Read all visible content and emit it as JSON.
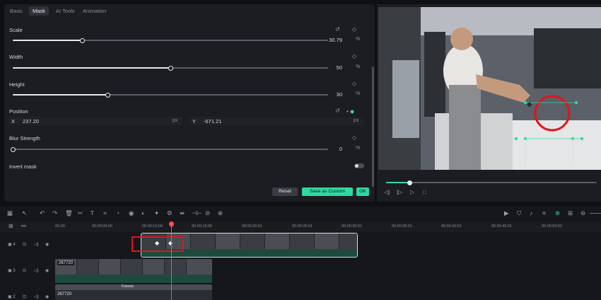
{
  "tabs": [
    "Basic",
    "Mask",
    "AI Tools",
    "Animation"
  ],
  "active_tab": "Mask",
  "scale": {
    "label": "Scale",
    "value": "30.79",
    "unit": "%",
    "fraction": 0.22
  },
  "width": {
    "label": "Width",
    "value": "50",
    "unit": "%",
    "fraction": 0.5
  },
  "height": {
    "label": "Height",
    "value": "30",
    "unit": "%",
    "fraction": 0.3
  },
  "position": {
    "label": "Position",
    "x_label": "X",
    "x_value": "237.20",
    "x_unit": "px",
    "y_label": "Y",
    "y_value": "-671.21",
    "y_unit": "px"
  },
  "blur": {
    "label": "Blur Strength",
    "value": "0",
    "unit": "%",
    "fraction": 0.0
  },
  "invert_mask": {
    "label": "Invert mask",
    "on": false
  },
  "buttons": {
    "reset": "Reset",
    "save_custom": "Save as Custom",
    "ok": "OK"
  },
  "player": {
    "progress": 0.11
  },
  "timeline": {
    "ruler": [
      "00:00",
      "00:00:05:00",
      "00:00:10:00",
      "00:00:15:00",
      "00:00:20:01",
      "00:00:25:01",
      "00:00:30:01",
      "00:00:35:01",
      "00:00:40:01",
      "00:00:45:01",
      "00:00:50:02"
    ],
    "tracks": [
      {
        "num": "4"
      },
      {
        "num": "3",
        "clip_label": "267720"
      },
      {
        "num": "2",
        "clip_label": "267720",
        "freeze_label": "Freeze"
      }
    ]
  },
  "colors": {
    "accent": "#2fd9a0",
    "panel": "#1b1d22",
    "highlight": "#e0141b",
    "playhead": "#ff4d5a"
  }
}
